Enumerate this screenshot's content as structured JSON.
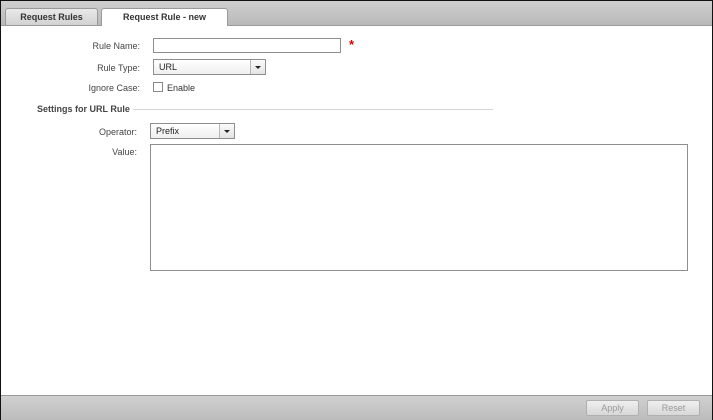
{
  "tabs": [
    {
      "label": "Request Rules",
      "active": false
    },
    {
      "label": "Request Rule - new",
      "active": true
    }
  ],
  "form": {
    "rule_name_label": "Rule Name:",
    "rule_name_value": "",
    "required_marker": "*",
    "rule_type_label": "Rule Type:",
    "rule_type_value": "URL",
    "ignore_case_label": "Ignore Case:",
    "enable_label": "Enable",
    "enable_checked": false,
    "section_title": "Settings for URL Rule",
    "operator_label": "Operator:",
    "operator_value": "Prefix",
    "value_label": "Value:",
    "value_text": ""
  },
  "footer": {
    "apply_label": "Apply",
    "reset_label": "Reset"
  },
  "colors": {
    "required": "#dd0000",
    "chrome": "#c4c4c4"
  },
  "icons": {
    "dropdown": "chevron-down-icon"
  }
}
